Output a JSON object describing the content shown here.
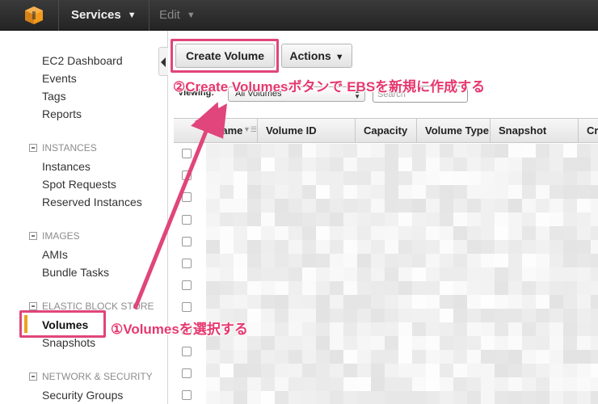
{
  "topbar": {
    "services_label": "Services",
    "edit_label": "Edit",
    "logo_color": "#f39a1d"
  },
  "sidebar": {
    "dashboard": "EC2 Dashboard",
    "events": "Events",
    "tags": "Tags",
    "reports": "Reports",
    "sections": [
      {
        "title": "INSTANCES",
        "items": [
          "Instances",
          "Spot Requests",
          "Reserved Instances"
        ]
      },
      {
        "title": "IMAGES",
        "items": [
          "AMIs",
          "Bundle Tasks"
        ]
      },
      {
        "title": "ELASTIC BLOCK STORE",
        "items": [
          "Volumes",
          "Snapshots"
        ]
      },
      {
        "title": "NETWORK & SECURITY",
        "items": [
          "Security Groups"
        ]
      }
    ],
    "active_item": "Volumes",
    "active_color": "#f0a01e"
  },
  "toolbar": {
    "create_volume_label": "Create Volume",
    "actions_label": "Actions",
    "viewing_label": "Viewing:",
    "viewing_value": "All Volumes",
    "search_placeholder": "Search"
  },
  "table": {
    "columns": [
      "Name",
      "Volume ID",
      "Capacity",
      "Volume Type",
      "Snapshot",
      "Cr"
    ],
    "row_count": 12
  },
  "annotations": {
    "note_create": "②Create Volumesボタンで EBSを新規に作成する",
    "note_volumes": "①Volumesを選択する",
    "color": "#e0457b"
  }
}
